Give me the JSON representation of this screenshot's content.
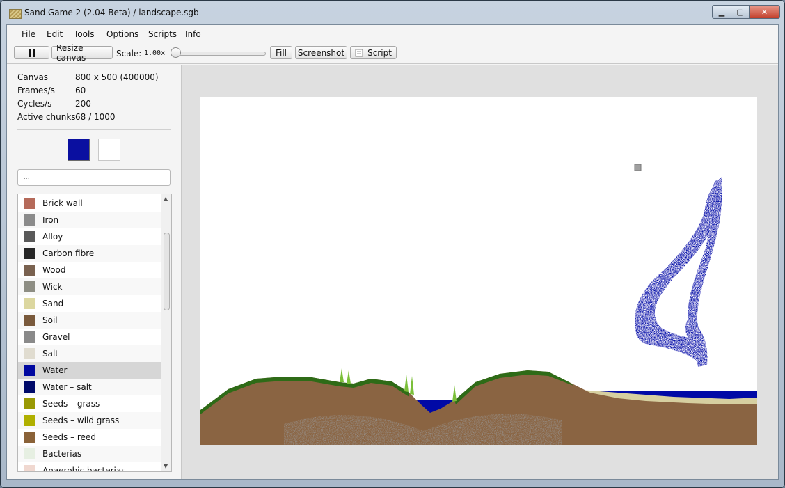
{
  "window": {
    "title": "Sand Game 2 (2.04 Beta) / landscape.sgb",
    "minimize_glyph": "▁",
    "maximize_glyph": "▢",
    "close_glyph": "✕",
    "icon": "sand-app-icon"
  },
  "menu": [
    "File",
    "Edit",
    "Tools",
    "Options",
    "Scripts",
    "Info"
  ],
  "toolbar": {
    "pause_icon": "pause-icon",
    "resize_label": "Resize canvas",
    "scale_label": "Scale:",
    "scale_value": "1.00x",
    "scale_slider_fraction": 0.0,
    "fill_label": "Fill",
    "screenshot_label": "Screenshot",
    "script_label": "Script",
    "script_icon": "script-icon"
  },
  "stats": [
    {
      "key": "Canvas",
      "value": "800 x 500 (400000)"
    },
    {
      "key": "Frames/s",
      "value": "60"
    },
    {
      "key": "Cycles/s",
      "value": "200"
    },
    {
      "key": "Active chunks",
      "value": "68 / 1000"
    }
  ],
  "brushes": {
    "primary_color": "#0a0fa0",
    "secondary_color": "#ffffff"
  },
  "search": {
    "placeholder": "..."
  },
  "materials": [
    {
      "label": "Brick wall",
      "color": "#b56a5a"
    },
    {
      "label": "Iron",
      "color": "#8c8c8c"
    },
    {
      "label": "Alloy",
      "color": "#5a5a5a"
    },
    {
      "label": "Carbon fibre",
      "color": "#262626"
    },
    {
      "label": "Wood",
      "color": "#7a6250"
    },
    {
      "label": "Wick",
      "color": "#8e8e84"
    },
    {
      "label": "Sand",
      "color": "#dcd7a0"
    },
    {
      "label": "Soil",
      "color": "#7a5a3c"
    },
    {
      "label": "Gravel",
      "color": "#8a8a8a"
    },
    {
      "label": "Salt",
      "color": "#e0dcd0"
    },
    {
      "label": "Water",
      "color": "#0008a0",
      "selected": true
    },
    {
      "label": "Water – salt",
      "color": "#000a6a"
    },
    {
      "label": "Seeds – grass",
      "color": "#9a9a05"
    },
    {
      "label": "Seeds – wild grass",
      "color": "#b0b000"
    },
    {
      "label": "Seeds – reed",
      "color": "#8a6238"
    },
    {
      "label": "Bacterias",
      "color": "#e6efe2"
    },
    {
      "label": "Anaerobic bacterias",
      "color": "#f0d8d0"
    }
  ],
  "colors": {
    "soil": "#8a6442",
    "soil_dark": "#6e4e32",
    "gravel": "#9a9a9a",
    "sand": "#d6cfa0",
    "grass": "#2e6b17",
    "reed": "#7bbf3a",
    "water": "#0009a6",
    "stone_block": "#a0a0a0"
  }
}
